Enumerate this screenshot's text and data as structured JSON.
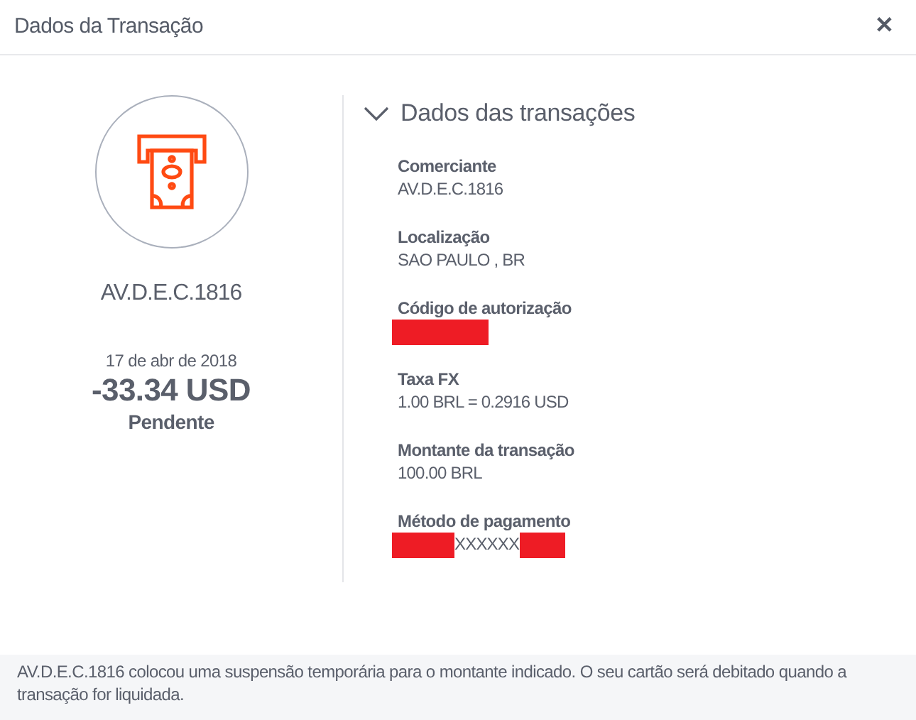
{
  "window": {
    "title": "Dados da Transação",
    "close": "✕"
  },
  "summary": {
    "merchant": "AV.D.E.C.1816",
    "date": "17 de abr de 2018",
    "amount": "-33.34 USD",
    "status": "Pendente"
  },
  "details": {
    "title": "Dados das transações",
    "expanded": true,
    "fields": [
      {
        "label": "Comerciante",
        "parts": [
          {
            "kind": "text",
            "text": "AV.D.E.C.1816"
          }
        ]
      },
      {
        "label": "Localização",
        "parts": [
          {
            "kind": "text",
            "text": "SAO PAULO , BR"
          }
        ]
      },
      {
        "label": "Código de autorização",
        "parts": [
          {
            "kind": "redacted"
          }
        ]
      },
      {
        "label": "Taxa FX",
        "parts": [
          {
            "kind": "text",
            "text": "1.00 BRL = 0.2916 USD"
          }
        ]
      },
      {
        "label": "Montante da transação",
        "parts": [
          {
            "kind": "text",
            "text": "100.00 BRL"
          }
        ]
      },
      {
        "label": "Método de pagamento",
        "parts": [
          {
            "kind": "redacted"
          },
          {
            "kind": "text",
            "text": "XXXXXX"
          },
          {
            "kind": "redacted"
          }
        ]
      }
    ]
  },
  "footer": {
    "note": "AV.D.E.C.1816 colocou uma suspensão temporária para o montante indicado. O seu cartão será debitado quando a transação for liquidada."
  }
}
